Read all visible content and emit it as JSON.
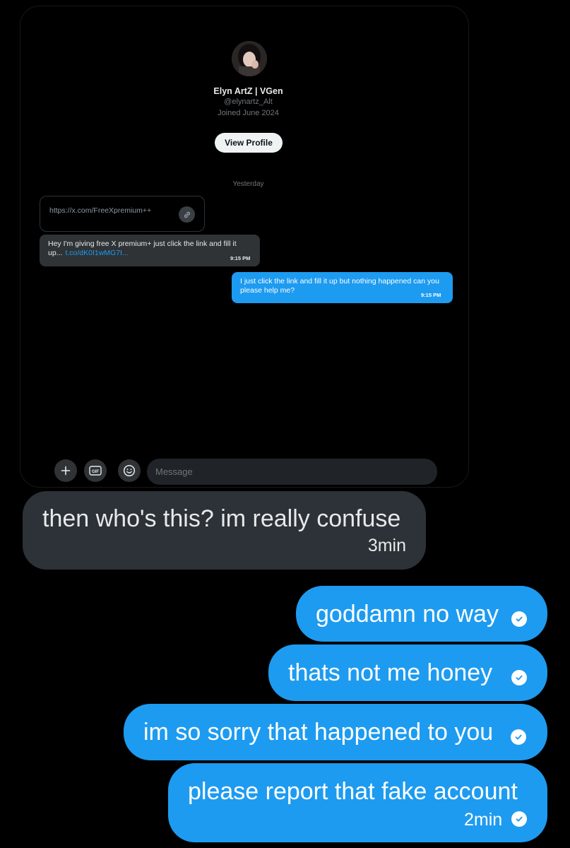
{
  "profile": {
    "display_name": "Elyn ArtZ | VGen",
    "handle": "@elynartz_Alt",
    "joined": "Joined June 2024",
    "view_profile_label": "View Profile"
  },
  "conversation": {
    "date_separator": "Yesterday",
    "link_card": {
      "url": "https://x.com/FreeXpremium++",
      "icon": "link-icon"
    },
    "incoming_message": {
      "text": "Hey I'm giving free X premium+ just click the link and fill it up...",
      "link_text": "t.co/dK0I1wMG7I...",
      "time": "9:15 PM"
    },
    "outgoing_message": {
      "text": "I just click the link and fill it up but nothing happened can you please help me?",
      "time": "9:15 PM"
    }
  },
  "composer": {
    "placeholder": "Message",
    "buttons": [
      "plus-icon",
      "gif-icon",
      "emoji-icon"
    ],
    "gif_label": "GIF"
  },
  "chat": {
    "incoming": {
      "text": "then who's this? im really confuse",
      "time": "3min"
    },
    "outgoing": [
      {
        "text": "goddamn no way"
      },
      {
        "text": "thats not me honey"
      },
      {
        "text": "im so sorry that happened to you"
      },
      {
        "text": "please report that fake account",
        "time": "2min"
      }
    ],
    "read_icon": "check-circle-icon"
  },
  "colors": {
    "accent": "#1d9bf0",
    "incoming_bubble": "#2f3336",
    "background": "#000000"
  }
}
